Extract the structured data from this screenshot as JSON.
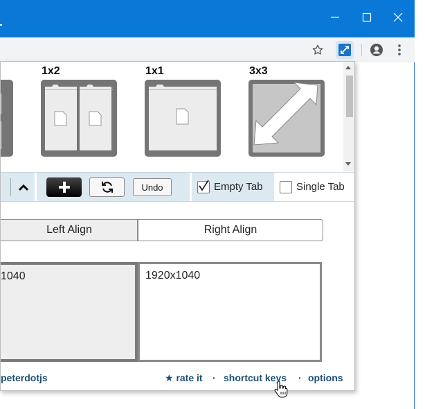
{
  "window": {
    "controls": {
      "minimize": "minimize-icon",
      "maximize": "maximize-icon",
      "close": "close-icon"
    }
  },
  "toolbar": {
    "icons": [
      "star-icon",
      "extension-resize-icon",
      "account-icon",
      "kebab-menu-icon"
    ],
    "active_accent": "#0a78d7"
  },
  "layouts": {
    "items": [
      {
        "label": "",
        "kind": "grid-partial"
      },
      {
        "label": "1x2",
        "kind": "two-columns"
      },
      {
        "label": "1x1",
        "kind": "single"
      },
      {
        "label": "3x3",
        "kind": "maximize"
      }
    ]
  },
  "controls": {
    "up_icon": "chevron-up-icon",
    "plus_icon": "plus-icon",
    "refresh_icon": "refresh-icon",
    "undo_label": "Undo",
    "empty_tab": {
      "label": "Empty Tab",
      "checked": true
    },
    "single_tab": {
      "label": "Single Tab",
      "checked": false
    }
  },
  "align": {
    "left_label": "Left Align",
    "right_label": "Right Align",
    "selected": "left"
  },
  "screens": {
    "left_resolution": "1040",
    "right_resolution": "1920x1040"
  },
  "footer": {
    "author": "peterdotjs",
    "rate": "★ rate it",
    "separator": "·",
    "shortcut_keys": "shortcut keys",
    "options": "options"
  },
  "colors": {
    "titlebar": "#0a78d7",
    "link": "#1d4f73",
    "controls_bg": "#dce9f0",
    "tile": "#757575"
  }
}
